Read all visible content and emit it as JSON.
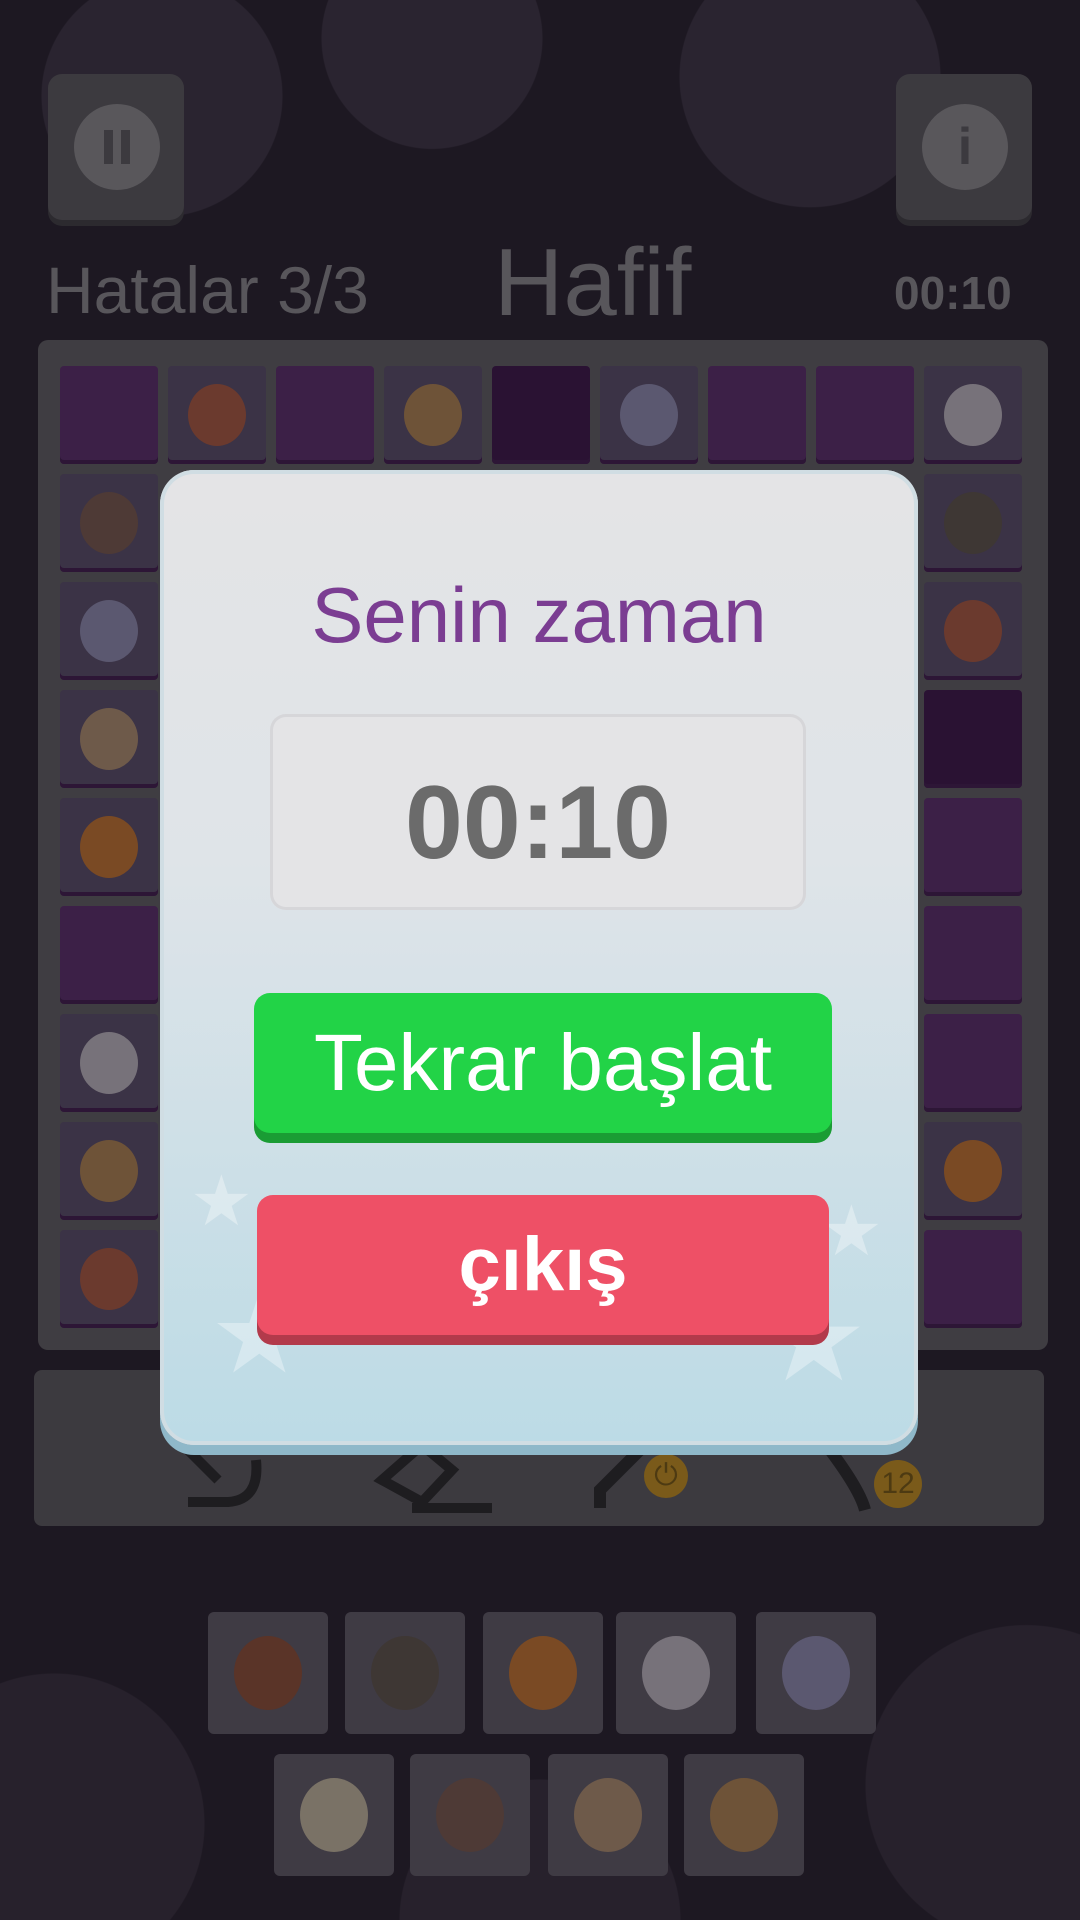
{
  "header": {
    "mistakes_label": "Hatalar 3/3",
    "difficulty": "Hafif",
    "timer": "00:10",
    "pause_icon": "pause-icon",
    "info_icon": "info-icon",
    "info_glyph": "i"
  },
  "toolbar": {
    "undo_icon": "undo-icon",
    "erase_icon": "eraser-icon",
    "pencil_icon": "pencil-icon",
    "hint_icon": "lightbulb-icon",
    "hint_count": "12"
  },
  "dialog": {
    "title": "Senin zaman",
    "time": "00:10",
    "restart_label": "Tekrar başlat",
    "exit_label": "çıkış"
  },
  "colors": {
    "title": "#7b3d92",
    "restart": "#22d347",
    "exit": "#ee5066"
  }
}
